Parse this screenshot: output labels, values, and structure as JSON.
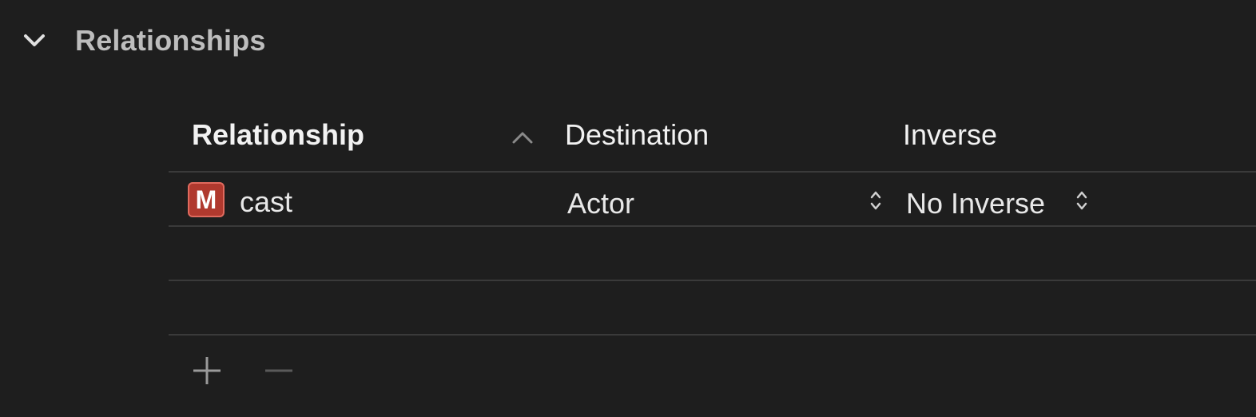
{
  "section": {
    "title": "Relationships",
    "expanded_icon": "chevron-down-icon"
  },
  "table": {
    "columns": {
      "relationship": "Relationship",
      "destination": "Destination",
      "inverse": "Inverse"
    },
    "sort_icon": "chevron-up-icon",
    "rows": [
      {
        "badge": "M",
        "name": "cast",
        "destination": "Actor",
        "inverse": "No Inverse"
      }
    ]
  },
  "footer": {
    "add_icon": "plus-icon",
    "remove_icon": "minus-icon"
  },
  "colors": {
    "background": "#1e1e1e",
    "badge": "#b0392e",
    "divider": "#3a3a3a"
  }
}
